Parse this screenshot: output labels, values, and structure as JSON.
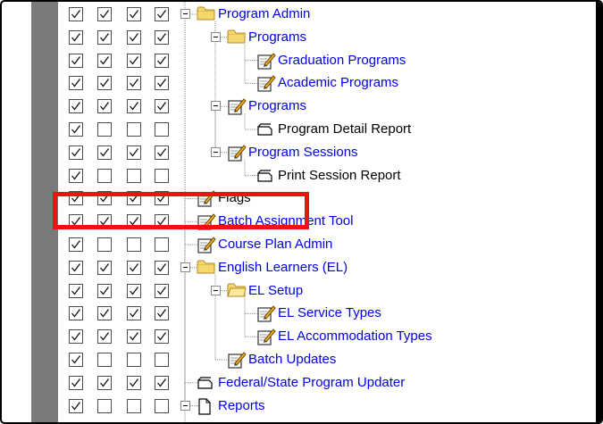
{
  "permission_columns": 4,
  "tree": [
    {
      "label": "Program Admin",
      "icon": "folder-icon",
      "depth": 0,
      "expander": true,
      "color": "blue",
      "checks": [
        true,
        true,
        true,
        true
      ]
    },
    {
      "label": "Programs",
      "icon": "folder-icon",
      "depth": 1,
      "expander": true,
      "color": "blue",
      "checks": [
        true,
        true,
        true,
        true
      ]
    },
    {
      "label": "Graduation Programs",
      "icon": "tool-edit-icon",
      "depth": 2,
      "expander": false,
      "color": "blue",
      "checks": [
        true,
        true,
        true,
        true
      ]
    },
    {
      "label": "Academic Programs",
      "icon": "tool-edit-icon",
      "depth": 2,
      "expander": false,
      "color": "blue",
      "checks": [
        true,
        true,
        true,
        true
      ]
    },
    {
      "label": "Programs",
      "icon": "tool-edit-icon",
      "depth": 1,
      "expander": true,
      "color": "blue",
      "checks": [
        true,
        true,
        true,
        true
      ]
    },
    {
      "label": "Program Detail Report",
      "icon": "report-icon",
      "depth": 2,
      "expander": false,
      "color": "black",
      "checks": [
        true,
        false,
        false,
        false
      ]
    },
    {
      "label": "Program Sessions",
      "icon": "tool-edit-icon",
      "depth": 1,
      "expander": true,
      "color": "blue",
      "checks": [
        true,
        true,
        true,
        true
      ]
    },
    {
      "label": "Print Session Report",
      "icon": "report-icon",
      "depth": 2,
      "expander": false,
      "color": "black",
      "checks": [
        true,
        false,
        false,
        false
      ]
    },
    {
      "label": "Flags",
      "icon": "tool-edit-icon",
      "depth": 0,
      "expander": false,
      "color": "black",
      "checks": [
        true,
        true,
        true,
        true
      ],
      "highlighted": true
    },
    {
      "label": "Batch Assignment Tool",
      "icon": "tool-edit-icon",
      "depth": 0,
      "expander": false,
      "color": "blue",
      "checks": [
        true,
        true,
        true,
        true
      ]
    },
    {
      "label": "Course Plan Admin",
      "icon": "tool-edit-icon",
      "depth": 0,
      "expander": false,
      "color": "blue",
      "checks": [
        true,
        false,
        false,
        false
      ]
    },
    {
      "label": "English Learners (EL)",
      "icon": "folder-icon",
      "depth": 0,
      "expander": true,
      "color": "blue",
      "checks": [
        true,
        true,
        true,
        true
      ]
    },
    {
      "label": "EL Setup",
      "icon": "folder-open-icon",
      "depth": 1,
      "expander": true,
      "color": "blue",
      "checks": [
        true,
        true,
        true,
        true
      ]
    },
    {
      "label": "EL Service Types",
      "icon": "tool-edit-icon",
      "depth": 2,
      "expander": false,
      "color": "blue",
      "checks": [
        true,
        true,
        true,
        true
      ]
    },
    {
      "label": "EL Accommodation Types",
      "icon": "tool-edit-icon",
      "depth": 2,
      "expander": false,
      "color": "blue",
      "checks": [
        true,
        true,
        true,
        true
      ]
    },
    {
      "label": "Batch Updates",
      "icon": "tool-edit-icon",
      "depth": 1,
      "expander": false,
      "color": "blue",
      "checks": [
        true,
        false,
        false,
        false
      ]
    },
    {
      "label": "Federal/State Program Updater",
      "icon": "report-icon",
      "depth": 0,
      "expander": false,
      "color": "blue",
      "checks": [
        true,
        true,
        true,
        true
      ]
    },
    {
      "label": "Reports",
      "icon": "page-icon",
      "depth": 0,
      "expander": true,
      "color": "blue",
      "checks": [
        true,
        false,
        false,
        false
      ]
    }
  ],
  "colors": {
    "link": "#0000e6",
    "highlight": "#ee1111",
    "folder": "#f5d76e",
    "sidebar": "#7a7a7a"
  }
}
